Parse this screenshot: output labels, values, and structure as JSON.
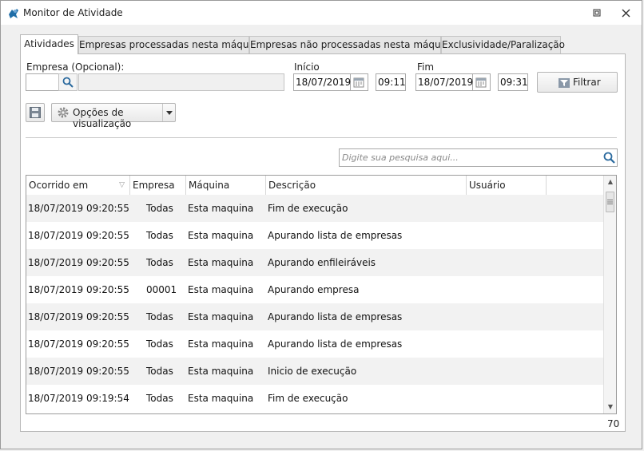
{
  "window": {
    "title": "Monitor de Atividade"
  },
  "tabs": [
    {
      "label": "Atividades",
      "active": true
    },
    {
      "label": "Empresas processadas nesta máquina",
      "active": false
    },
    {
      "label": "Empresas não processadas nesta máquina",
      "active": false
    },
    {
      "label": "Exclusividade/Paralização",
      "active": false
    }
  ],
  "filters": {
    "empresa_label": "Empresa (Opcional):",
    "empresa_code": "",
    "empresa_name": "",
    "inicio_label": "Início",
    "inicio_date": "18/07/2019",
    "inicio_time": "09:11",
    "fim_label": "Fim",
    "fim_date": "18/07/2019",
    "fim_time": "09:31",
    "filter_button": "Filtrar"
  },
  "toolbar": {
    "view_options": "Opções de visualização"
  },
  "search": {
    "placeholder": "Digite sua pesquisa aqui..."
  },
  "grid": {
    "columns": [
      "Ocorrido em",
      "Empresa",
      "Máquina",
      "Descrição",
      "Usuário"
    ],
    "rows": [
      {
        "date": "18/07/2019 09:20:55",
        "empresa": "Todas",
        "maquina": "Esta maquina",
        "descricao": "Fim de execução",
        "usuario": ""
      },
      {
        "date": "18/07/2019 09:20:55",
        "empresa": "Todas",
        "maquina": "Esta maquina",
        "descricao": "Apurando lista de empresas",
        "usuario": ""
      },
      {
        "date": "18/07/2019 09:20:55",
        "empresa": "Todas",
        "maquina": "Esta maquina",
        "descricao": "Apurando enfileiráveis",
        "usuario": ""
      },
      {
        "date": "18/07/2019 09:20:55",
        "empresa": "00001",
        "maquina": "Esta maquina",
        "descricao": "Apurando empresa",
        "usuario": ""
      },
      {
        "date": "18/07/2019 09:20:55",
        "empresa": "Todas",
        "maquina": "Esta maquina",
        "descricao": "Apurando lista de empresas",
        "usuario": ""
      },
      {
        "date": "18/07/2019 09:20:55",
        "empresa": "Todas",
        "maquina": "Esta maquina",
        "descricao": "Apurando lista de empresas",
        "usuario": ""
      },
      {
        "date": "18/07/2019 09:20:55",
        "empresa": "Todas",
        "maquina": "Esta maquina",
        "descricao": "Inicio de execução",
        "usuario": ""
      },
      {
        "date": "18/07/2019 09:19:54",
        "empresa": "Todas",
        "maquina": "Esta maquina",
        "descricao": "Fim de execução",
        "usuario": ""
      }
    ]
  },
  "footer": {
    "count": "70"
  },
  "colors": {
    "accent": "#1f6ea8",
    "row_alt": "#f2f2f2"
  },
  "icons": [
    "app-icon",
    "restore-icon",
    "close-icon",
    "search-icon",
    "calendar-icon",
    "filter-icon",
    "save-icon",
    "gear-icon",
    "chevron-down-icon"
  ]
}
